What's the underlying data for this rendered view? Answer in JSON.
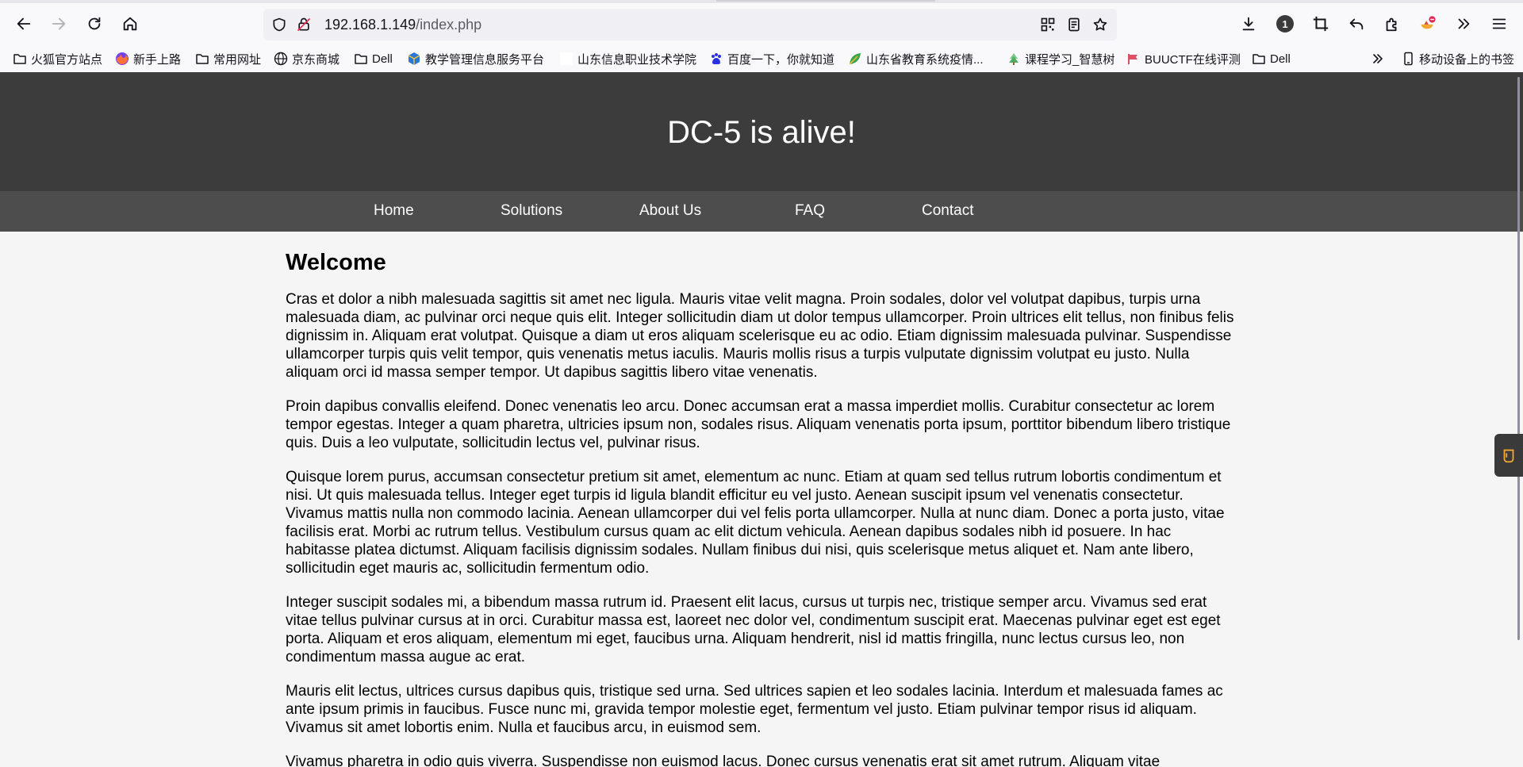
{
  "browser": {
    "url_host": "192.168.1.149",
    "url_path": "/index.php",
    "download_badge": "1",
    "bookmarks": [
      {
        "label": "火狐官方站点",
        "icon": "folder-icon"
      },
      {
        "label": "新手上路",
        "icon": "firefox-icon"
      },
      {
        "label": "常用网址",
        "icon": "folder-icon"
      },
      {
        "label": "京东商城",
        "icon": "globe-icon"
      },
      {
        "label": "Dell",
        "icon": "folder-icon"
      },
      {
        "label": "教学管理信息服务平台",
        "icon": "cube-icon"
      },
      {
        "label": "山东信息职业技术学院",
        "icon": "blank-icon"
      },
      {
        "label": "百度一下，你就知道",
        "icon": "paw-icon"
      },
      {
        "label": "山东省教育系统疫情...",
        "icon": "leaf-icon"
      },
      {
        "label": "课程学习_智慧树",
        "icon": "tree-icon"
      },
      {
        "label": "BUUCTF在线评测",
        "icon": "flag-icon"
      },
      {
        "label": "Dell",
        "icon": "folder-icon"
      }
    ],
    "mobile_bookmarks": "移动设备上的书签"
  },
  "site": {
    "title": "DC-5 is alive!",
    "nav": [
      "Home",
      "Solutions",
      "About Us",
      "FAQ",
      "Contact"
    ],
    "heading": "Welcome",
    "paragraphs": [
      "Cras et dolor a nibh malesuada sagittis sit amet nec ligula. Mauris vitae velit magna. Proin sodales, dolor vel volutpat dapibus, turpis urna malesuada diam, ac pulvinar orci neque quis elit. Integer sollicitudin diam ut dolor tempus ullamcorper. Proin ultrices elit tellus, non finibus felis dignissim in. Aliquam erat volutpat. Quisque a diam ut eros aliquam scelerisque eu ac odio. Etiam dignissim malesuada pulvinar. Suspendisse ullamcorper turpis quis velit tempor, quis venenatis metus iaculis. Mauris mollis risus a turpis vulputate dignissim volutpat eu justo. Nulla aliquam orci id massa semper tempor. Ut dapibus sagittis libero vitae venenatis.",
      "Proin dapibus convallis eleifend. Donec venenatis leo arcu. Donec accumsan erat a massa imperdiet mollis. Curabitur consectetur ac lorem tempor egestas. Integer a quam pharetra, ultricies ipsum non, sodales risus. Aliquam venenatis porta ipsum, porttitor bibendum libero tristique quis. Duis a leo vulputate, sollicitudin lectus vel, pulvinar risus.",
      "Quisque lorem purus, accumsan consectetur pretium sit amet, elementum ac nunc. Etiam at quam sed tellus rutrum lobortis condimentum et nisi. Ut quis malesuada tellus. Integer eget turpis id ligula blandit efficitur eu vel justo. Aenean suscipit ipsum vel venenatis consectetur. Vivamus mattis nulla non commodo lacinia. Aenean ullamcorper dui vel felis porta ullamcorper. Nulla at nunc diam. Donec a porta justo, vitae facilisis erat. Morbi ac rutrum tellus. Vestibulum cursus quam ac elit dictum vehicula. Aenean dapibus sodales nibh id posuere. In hac habitasse platea dictumst. Aliquam facilisis dignissim sodales. Nullam finibus dui nisi, quis scelerisque metus aliquet et. Nam ante libero, sollicitudin eget mauris ac, sollicitudin fermentum odio.",
      "Integer suscipit sodales mi, a bibendum massa rutrum id. Praesent elit lacus, cursus ut turpis nec, tristique semper arcu. Vivamus sed erat vitae tellus pulvinar cursus at in orci. Curabitur massa est, laoreet nec dolor vel, condimentum suscipit erat. Maecenas pulvinar eget est eget porta. Aliquam et eros aliquam, elementum mi eget, faucibus urna. Aliquam hendrerit, nisl id mattis fringilla, nunc lectus cursus leo, non condimentum massa augue ac erat.",
      "Mauris elit lectus, ultrices cursus dapibus quis, tristique sed urna. Sed ultrices sapien et leo sodales lacinia. Interdum et malesuada fames ac ante ipsum primis in faucibus. Fusce nunc mi, gravida tempor molestie eget, fermentum vel justo. Etiam pulvinar tempor risus id aliquam. Vivamus sit amet lobortis enim. Nulla et faucibus arcu, in euismod sem.",
      "Vivamus pharetra in odio quis viverra. Suspendisse non euismod lacus. Donec cursus venenatis erat sit amet rutrum. Aliquam vitae"
    ]
  }
}
